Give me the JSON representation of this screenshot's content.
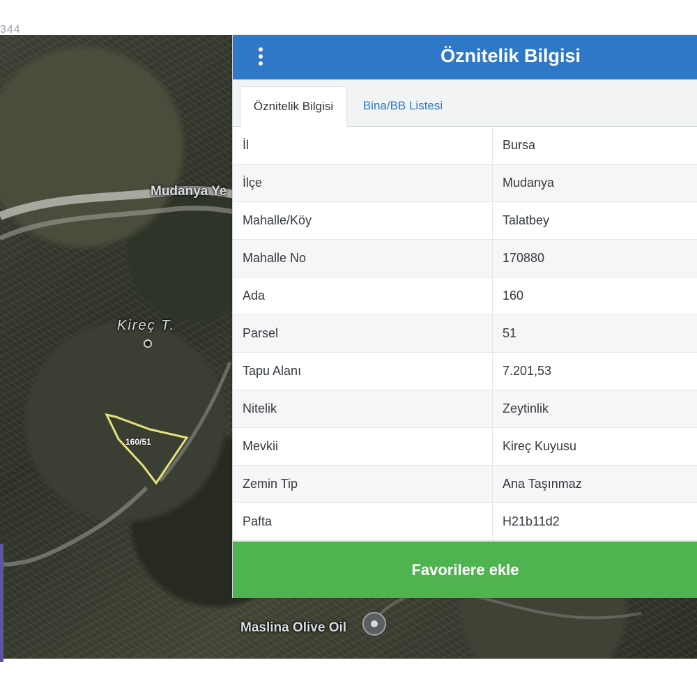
{
  "corner_label": "344",
  "map": {
    "road_label": "Mudanya Ye",
    "hill_label": "Kireç T.",
    "poi_label": "Maslina Olive Oil",
    "parcel_label": "160/51"
  },
  "panel": {
    "title": "Öznitelik Bilgisi",
    "tabs": [
      {
        "label": "Öznitelik Bilgisi",
        "active": true
      },
      {
        "label": "Bina/BB Listesi",
        "active": false
      }
    ],
    "rows": [
      {
        "key": "İl",
        "value": "Bursa"
      },
      {
        "key": "İlçe",
        "value": "Mudanya"
      },
      {
        "key": "Mahalle/Köy",
        "value": "Talatbey"
      },
      {
        "key": "Mahalle No",
        "value": "170880"
      },
      {
        "key": "Ada",
        "value": "160"
      },
      {
        "key": "Parsel",
        "value": "51"
      },
      {
        "key": "Tapu Alanı",
        "value": "7.201,53"
      },
      {
        "key": "Nitelik",
        "value": "Zeytinlik"
      },
      {
        "key": "Mevkii",
        "value": "Kireç Kuyusu"
      },
      {
        "key": "Zemin Tip",
        "value": "Ana Taşınmaz"
      },
      {
        "key": "Pafta",
        "value": "H21b11d2"
      }
    ],
    "favorite_button": "Favorilere ekle"
  },
  "colors": {
    "header_blue": "#2f78c8",
    "button_green": "#4fb34f",
    "parcel_outline": "#e6e27a"
  }
}
